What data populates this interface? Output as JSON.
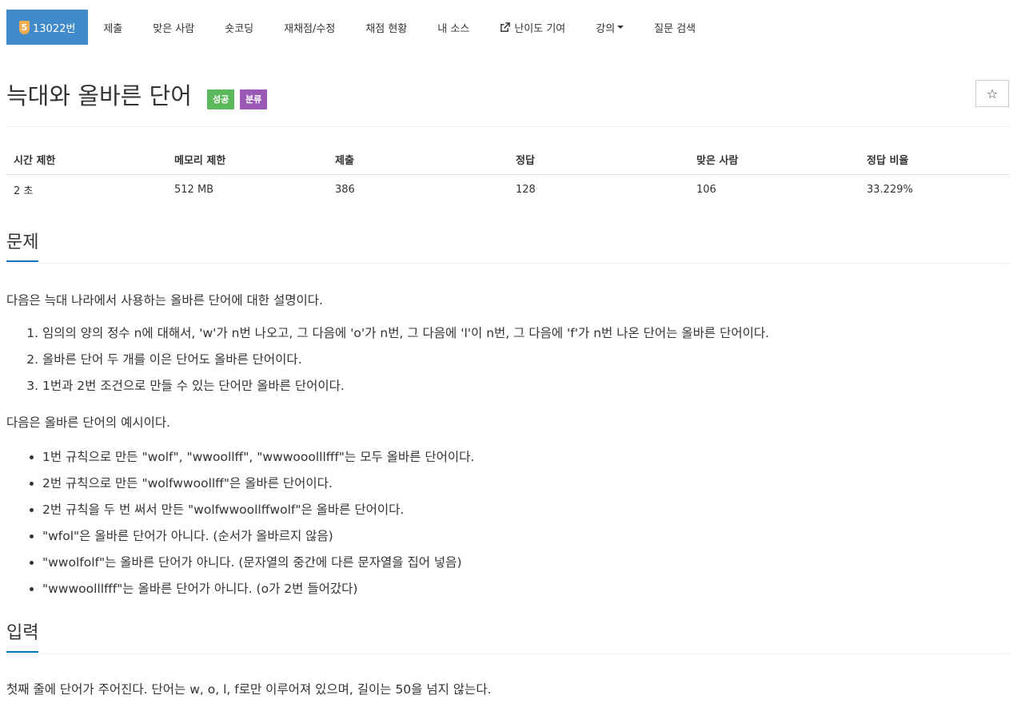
{
  "nav": {
    "problem_badge": "5",
    "problem_number": "13022번",
    "items": [
      "제출",
      "맞은 사람",
      "숏코딩",
      "재채점/수정",
      "채점 현황",
      "내 소스"
    ],
    "difficulty": "난이도 기여",
    "lecture": "강의",
    "search": "질문 검색"
  },
  "problem": {
    "title": "늑대와 올바른 단어",
    "label_success": "성공",
    "label_tag": "분류",
    "star": "☆"
  },
  "stats": {
    "headers": [
      "시간 제한",
      "메모리 제한",
      "제출",
      "정답",
      "맞은 사람",
      "정답 비율"
    ],
    "values": [
      "2 초",
      "512 MB",
      "386",
      "128",
      "106",
      "33.229%"
    ]
  },
  "sections": {
    "problem_heading": "문제",
    "input_heading": "입력"
  },
  "description": {
    "intro": "다음은 늑대 나라에서 사용하는 올바른 단어에 대한 설명이다.",
    "rules": [
      "임의의 양의 정수 n에 대해서, 'w'가 n번 나오고, 그 다음에 'o'가 n번, 그 다음에 'l'이 n번, 그 다음에 'f'가 n번 나온 단어는 올바른 단어이다.",
      "올바른 단어 두 개를 이은 단어도 올바른 단어이다.",
      "1번과 2번 조건으로 만들 수 있는 단어만 올바른 단어이다."
    ],
    "examples_intro": "다음은 올바른 단어의 예시이다.",
    "examples": [
      "1번 규칙으로 만든 \"wolf\", \"wwoollff\", \"wwwooolllfff\"는 모두 올바른 단어이다.",
      "2번 규칙으로 만든 \"wolfwwoollff\"은 올바른 단어이다.",
      "2번 규칙을 두 번 써서 만든 \"wolfwwoollffwolf\"은 올바른 단어이다.",
      "\"wfol\"은 올바른 단어가 아니다. (순서가 올바르지 않음)",
      "\"wwolfolf\"는 올바른 단어가 아니다. (문자열의 중간에 다른 문자열을 집어 넣음)",
      "\"wwwoolllfff\"는 올바른 단어가 아니다. (o가 2번 들어갔다)"
    ],
    "input_text": "첫째 줄에 단어가 주어진다. 단어는 w, o, l, f로만 이루어져 있으며, 길이는 50을 넘지 않는다."
  },
  "colors": {
    "nav_active": "#428bca",
    "badge": "#f0ad4e",
    "label_success": "#5cb85c",
    "label_tag": "#9b59b6",
    "heading_underline": "#0076c0"
  }
}
